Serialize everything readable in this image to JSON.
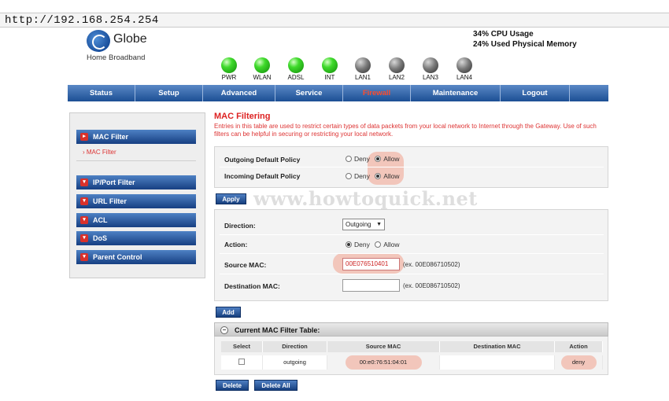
{
  "browser": {
    "url": "http://192.168.254.254"
  },
  "brand": {
    "name": "Globe",
    "subtitle": "Home Broadband",
    "logo_icon": "globe-logo-icon",
    "colors": {
      "nav": "#1c4f94",
      "accent_red": "#dd2222",
      "led_on": "#3fda2b",
      "led_off": "#555555",
      "highlight": "#f0a08c"
    }
  },
  "system": {
    "cpu": "34% CPU Usage",
    "memory": "24% Used Physical Memory"
  },
  "leds": [
    {
      "label": "PWR",
      "state": "on"
    },
    {
      "label": "WLAN",
      "state": "on"
    },
    {
      "label": "ADSL",
      "state": "on"
    },
    {
      "label": "INT",
      "state": "on"
    },
    {
      "label": "LAN1",
      "state": "off"
    },
    {
      "label": "LAN2",
      "state": "off"
    },
    {
      "label": "LAN3",
      "state": "off"
    },
    {
      "label": "LAN4",
      "state": "off"
    }
  ],
  "nav": {
    "items": [
      "Status",
      "Setup",
      "Advanced",
      "Service",
      "Firewall",
      "Maintenance",
      "Logout"
    ],
    "active": "Firewall"
  },
  "sidebar": {
    "mac_filter": "MAC Filter",
    "mac_filter_sub": "MAC Filter",
    "ip_port_filter": "IP/Port Filter",
    "url_filter": "URL Filter",
    "acl": "ACL",
    "dos": "DoS",
    "parent_control": "Parent Control"
  },
  "page": {
    "title": "MAC Filtering",
    "description": "Entries in this table are used to restrict certain types of data packets from your local network to Internet through the Gateway. Use of such filters can be helpful in securing or restricting your local network."
  },
  "policy": {
    "outgoing_label": "Outgoing Default Policy",
    "incoming_label": "Incoming Default Policy",
    "deny": "Deny",
    "allow": "Allow",
    "outgoing_value": "Allow",
    "incoming_value": "Allow",
    "apply_button": "Apply"
  },
  "rule_form": {
    "direction_label": "Direction:",
    "direction_value": "Outgoing",
    "action_label": "Action:",
    "action_deny": "Deny",
    "action_allow": "Allow",
    "action_value": "Deny",
    "source_mac_label": "Source MAC:",
    "source_mac_value": "00E076510401",
    "source_mac_hint": "(ex. 00E086710502)",
    "dest_mac_label": "Destination MAC:",
    "dest_mac_value": "",
    "dest_mac_hint": "(ex. 00E086710502)",
    "add_button": "Add"
  },
  "watermark": "www.howtoquick.net",
  "filter_table": {
    "title": "Current MAC Filter Table:",
    "columns": [
      "Select",
      "Direction",
      "Source MAC",
      "Destination MAC",
      "Action"
    ],
    "rows": [
      {
        "direction": "outgoing",
        "source_mac": "00:e0:76:51:04:01",
        "destination_mac": "",
        "action": "deny"
      }
    ],
    "delete_button": "Delete",
    "delete_all_button": "Delete All"
  }
}
